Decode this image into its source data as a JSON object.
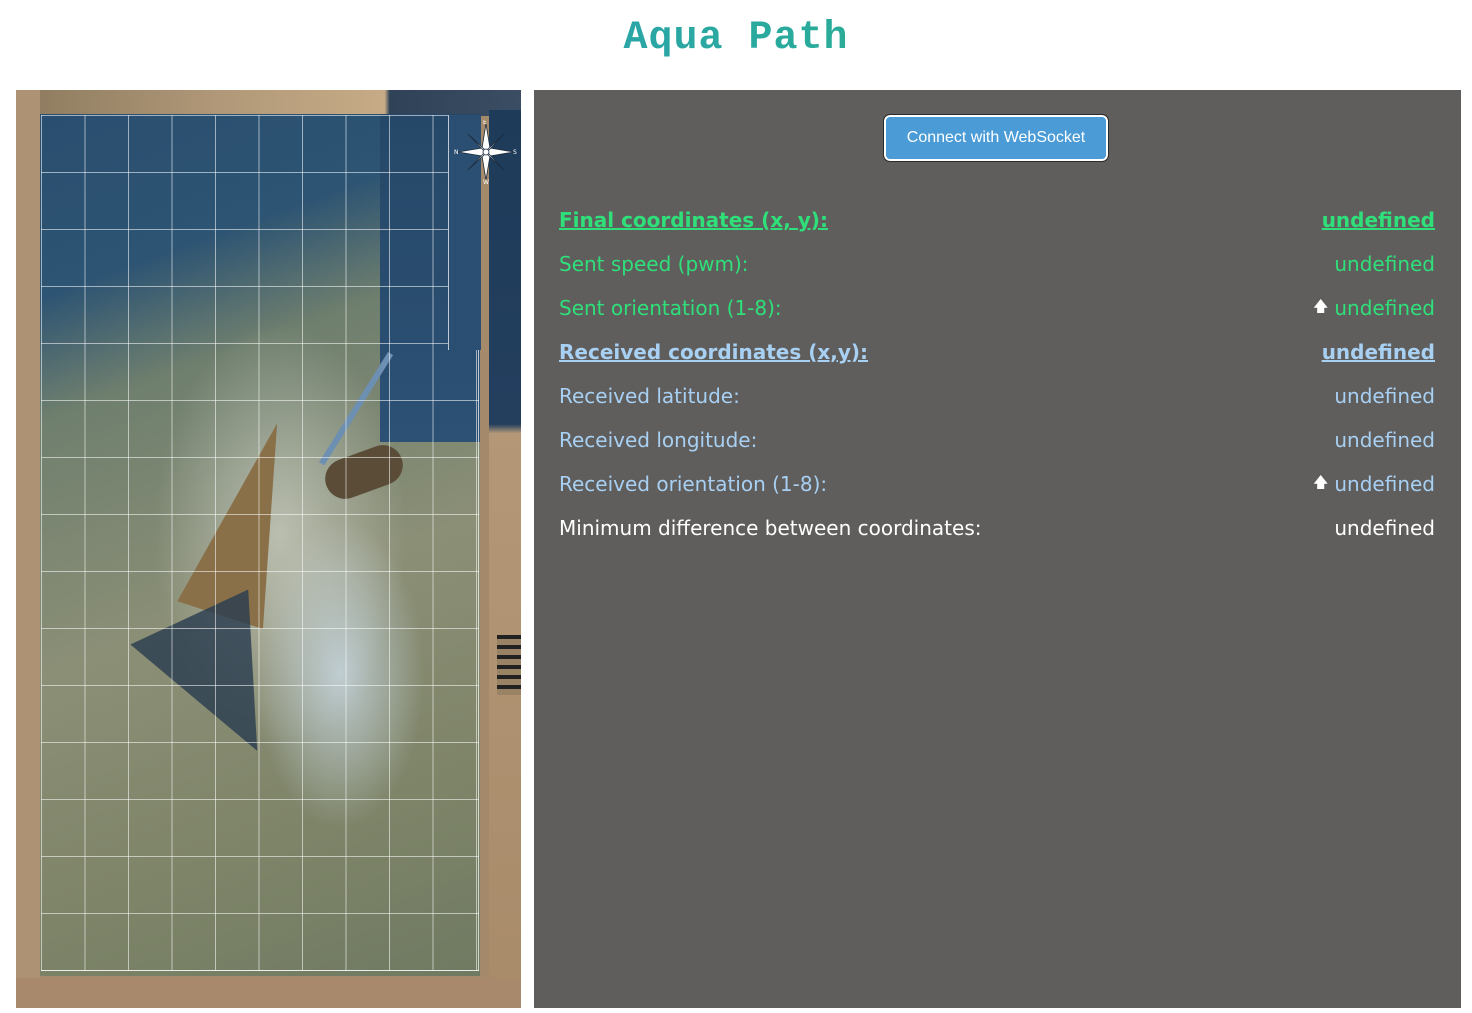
{
  "header": {
    "title": "Aqua Path"
  },
  "map": {
    "compass_icon": "compass-rose-icon",
    "compass_labels": {
      "n": "N",
      "e": "E",
      "s": "S",
      "w": "W"
    }
  },
  "panel": {
    "connect_button": "Connect with WebSocket",
    "rows": [
      {
        "label": "Final coordinates (x, y):",
        "value": "undefined"
      },
      {
        "label": "Sent speed (pwm):",
        "value": "undefined"
      },
      {
        "label": "Sent orientation (1-8):",
        "value": "undefined",
        "icon": "arrow-up-icon"
      },
      {
        "label": "Received coordinates (x,y):",
        "value": "undefined"
      },
      {
        "label": "Received latitude:",
        "value": "undefined"
      },
      {
        "label": "Received longitude:",
        "value": "undefined"
      },
      {
        "label": "Received orientation (1-8):",
        "value": "undefined",
        "icon": "arrow-up-icon"
      },
      {
        "label": "Minimum difference between coordinates:",
        "value": "undefined"
      }
    ],
    "arrow_glyph": "🡅",
    "colors": {
      "sent": "#2fe07a",
      "received": "#a8d0f2",
      "other": "#ffffff",
      "panel_bg": "#5f5e5d",
      "button": "#4a9bd6"
    }
  }
}
